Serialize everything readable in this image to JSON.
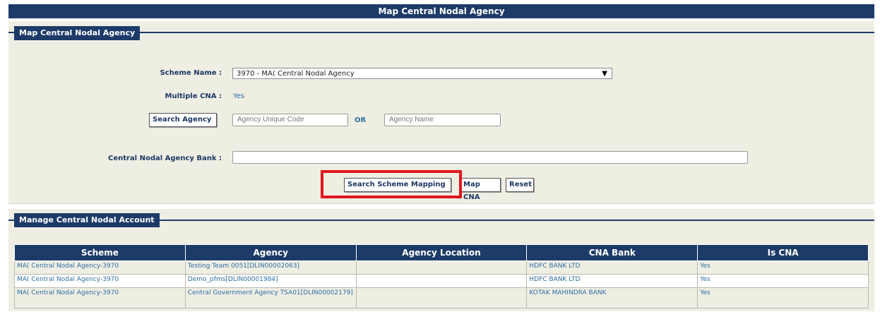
{
  "page": {
    "title": "Map Central Nodal Agency"
  },
  "section1": {
    "legend": "Map Central Nodal Agency",
    "scheme_label": "Scheme Name :",
    "scheme_value": "3970 - MA( Central Nodal Agency",
    "multiple_cna_label": "Multiple CNA :",
    "multiple_cna_value": "Yes",
    "search_agency_button": "Search Agency",
    "agency_code_placeholder": "Agency Unique Code",
    "or_label": "OR",
    "agency_name_placeholder": "Agency Name",
    "cna_bank_label": "Central Nodal Agency Bank :",
    "cna_bank_value": "",
    "search_mapping_button": "Search Scheme Mapping",
    "map_cna_button": "Map CNA",
    "reset_button": "Reset"
  },
  "section2": {
    "legend": "Manage Central Nodal Account",
    "columns": [
      "Scheme",
      "Agency",
      "Agency Location",
      "CNA Bank",
      "Is CNA"
    ],
    "rows": [
      [
        "MA( Central Nodal Agency-3970",
        "Testing Team 0051[DLIN00002063]",
        "",
        "HDFC BANK LTD",
        "Yes"
      ],
      [
        "MA( Central Nodal Agency-3970",
        "Demo_pfms[DLIN00001984]",
        "",
        "HDFC BANK LTD",
        "Yes"
      ],
      [
        "MA( Central Nodal Agency-3970",
        "Central Government Agency TSA01[DLIN00002179]",
        "",
        "KOTAK MAHINDRA BANK",
        "Yes"
      ]
    ]
  },
  "colors": {
    "header": "#1d3b68",
    "panel": "#eeeee3",
    "highlight": "#e4151d",
    "link": "#2e6da4"
  }
}
